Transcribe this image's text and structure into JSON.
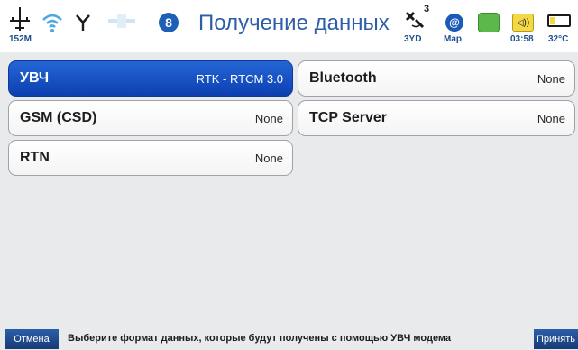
{
  "status_bar": {
    "network_label": "152M",
    "title": "Получение данных",
    "bluetooth_glyph": "8",
    "satellites": {
      "count": "3",
      "label": "3YD"
    },
    "map": {
      "glyph": "@",
      "label": "Map"
    },
    "volume_glyph": "◁))",
    "time": "03:58",
    "temperature": "32°C"
  },
  "options": [
    {
      "id": "uvch",
      "name": "УВЧ",
      "value": "RTK - RTCM 3.0",
      "selected": true
    },
    {
      "id": "gsm",
      "name": "GSM (CSD)",
      "value": "None",
      "selected": false
    },
    {
      "id": "rtn",
      "name": "RTN",
      "value": "None",
      "selected": false
    },
    {
      "id": "bluetooth",
      "name": "Bluetooth",
      "value": "None",
      "selected": false
    },
    {
      "id": "tcp",
      "name": "TCP Server",
      "value": "None",
      "selected": false
    }
  ],
  "bottom": {
    "cancel_label": "Отмена",
    "hint": "Выберите формат данных, которые будут получены с помощью УВЧ модема",
    "accept_label": "Принять"
  },
  "colors": {
    "selected": "#1447c0",
    "title": "#2f5ea8",
    "button": "#1f4d91"
  }
}
